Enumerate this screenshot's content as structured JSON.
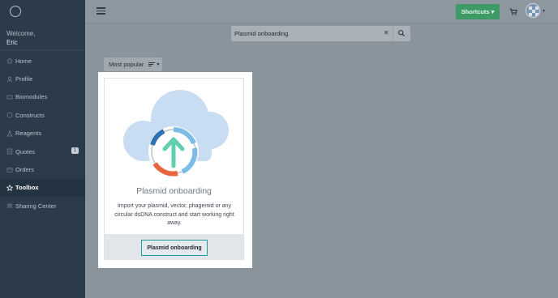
{
  "sidebar": {
    "welcome": "Welcome,",
    "user_name": "Eric",
    "items": [
      {
        "label": "Home",
        "icon": "home-icon"
      },
      {
        "label": "Profile",
        "icon": "user-icon"
      },
      {
        "label": "Biomodules",
        "icon": "biomodule-icon"
      },
      {
        "label": "Constructs",
        "icon": "construct-icon"
      },
      {
        "label": "Reagents",
        "icon": "flask-icon"
      },
      {
        "label": "Quotes",
        "icon": "quote-icon",
        "badge": "1"
      },
      {
        "label": "Orders",
        "icon": "orders-icon"
      },
      {
        "label": "Toolbox",
        "icon": "star-icon",
        "active": true
      },
      {
        "label": "Sharing Center",
        "icon": "share-icon"
      }
    ]
  },
  "topbar": {
    "shortcuts_label": "Shortcuts ▾",
    "cart_icon": "cart-icon",
    "avatar_caret": "▾"
  },
  "search": {
    "value": "Plasmid onboarding",
    "clear_icon": "✕"
  },
  "sort": {
    "label": "Most popular"
  },
  "card": {
    "title": "Plasmid onboarding",
    "description": "Import your plasmid, vector, phagemid or any circular dsDNA construct and start working right away.",
    "button_label": "Plasmid onboarding"
  },
  "colors": {
    "sidebar_bg": "#2b3b4b",
    "accent_green": "#3e9a67",
    "button_border": "#1f9a9b",
    "cloud": "#c9ddf2"
  }
}
